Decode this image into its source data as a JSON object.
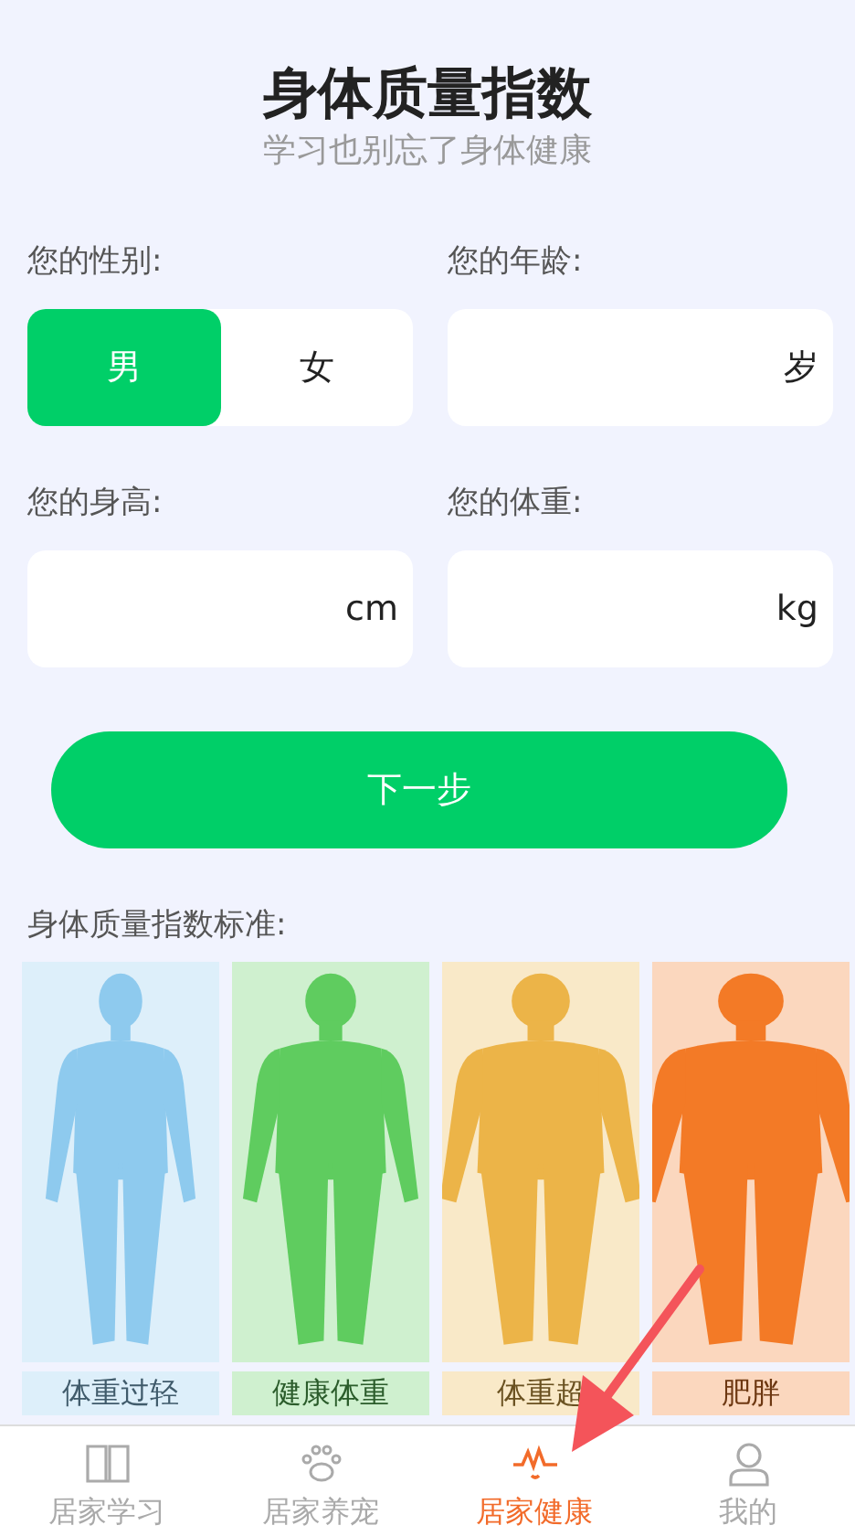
{
  "header": {
    "title": "身体质量指数",
    "subtitle": "学习也别忘了身体健康"
  },
  "gender": {
    "label": "您的性别:",
    "options": [
      {
        "label": "男",
        "selected": true
      },
      {
        "label": "女",
        "selected": false
      }
    ]
  },
  "age": {
    "label": "您的年龄:",
    "unit": "岁"
  },
  "height": {
    "label": "您的身高:",
    "unit": "cm"
  },
  "weight": {
    "label": "您的体重:",
    "unit": "kg"
  },
  "next_button": "下一步",
  "standard": {
    "label": "身体质量指数标准:",
    "categories": [
      {
        "label": "体重过轻",
        "color": "#8ecaee"
      },
      {
        "label": "健康体重",
        "color": "#5fcc5f"
      },
      {
        "label": "体重超",
        "color": "#ecb448"
      },
      {
        "label": "肥胖",
        "color": "#f37a26"
      }
    ]
  },
  "annotation": {
    "kind": "arrow"
  },
  "tabs": [
    {
      "label": "居家学习",
      "selected": false
    },
    {
      "label": "居家养宠",
      "selected": false
    },
    {
      "label": "居家健康",
      "selected": true
    },
    {
      "label": "我的",
      "selected": false
    }
  ]
}
